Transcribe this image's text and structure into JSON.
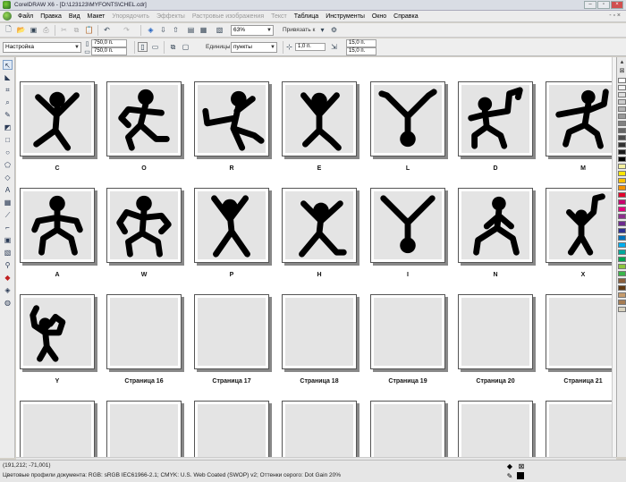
{
  "window": {
    "title": "CorelDRAW X6 - [D:\\123123\\MYFONTS\\CHEL.cdr]"
  },
  "menu": {
    "items": [
      {
        "label": "Файл",
        "enabled": true
      },
      {
        "label": "Правка",
        "enabled": true
      },
      {
        "label": "Вид",
        "enabled": true
      },
      {
        "label": "Макет",
        "enabled": true
      },
      {
        "label": "Упорядочить",
        "enabled": false
      },
      {
        "label": "Эффекты",
        "enabled": false
      },
      {
        "label": "Растровые изображения",
        "enabled": false
      },
      {
        "label": "Текст",
        "enabled": false
      },
      {
        "label": "Таблица",
        "enabled": true
      },
      {
        "label": "Инструменты",
        "enabled": true
      },
      {
        "label": "Окно",
        "enabled": true
      },
      {
        "label": "Справка",
        "enabled": true
      }
    ],
    "right_controls": "- ▫ ×"
  },
  "toolbar": {
    "zoom": "63%",
    "snap_label": "Привязать к"
  },
  "property_bar": {
    "preset": "Настройка",
    "width": "750,0 п.",
    "height": "750,0 п.",
    "units_label": "Единицы:",
    "units_value": "пункты",
    "nudge": "1,0 п.",
    "dup_x": "15,0 п.",
    "dup_y": "15,0 п."
  },
  "pages": [
    {
      "caption": "C",
      "glyph": "C"
    },
    {
      "caption": "O",
      "glyph": "O"
    },
    {
      "caption": "R",
      "glyph": "R"
    },
    {
      "caption": "E",
      "glyph": "E"
    },
    {
      "caption": "L",
      "glyph": "L"
    },
    {
      "caption": "D",
      "glyph": "D"
    },
    {
      "caption": "M",
      "glyph": "M"
    },
    {
      "caption": "A",
      "glyph": "A"
    },
    {
      "caption": "W",
      "glyph": "W"
    },
    {
      "caption": "P",
      "glyph": "P"
    },
    {
      "caption": "H",
      "glyph": "H"
    },
    {
      "caption": "I",
      "glyph": "I"
    },
    {
      "caption": "N",
      "glyph": "N"
    },
    {
      "caption": "X",
      "glyph": "X"
    },
    {
      "caption": "Y",
      "glyph": "Y"
    },
    {
      "caption": "Страница 16",
      "glyph": ""
    },
    {
      "caption": "Страница 17",
      "glyph": ""
    },
    {
      "caption": "Страница 18",
      "glyph": ""
    },
    {
      "caption": "Страница 19",
      "glyph": ""
    },
    {
      "caption": "Страница 20",
      "glyph": ""
    },
    {
      "caption": "Страница 21",
      "glyph": ""
    },
    {
      "caption": "",
      "glyph": ""
    },
    {
      "caption": "",
      "glyph": ""
    },
    {
      "caption": "",
      "glyph": ""
    },
    {
      "caption": "",
      "glyph": ""
    },
    {
      "caption": "",
      "glyph": ""
    },
    {
      "caption": "",
      "glyph": ""
    },
    {
      "caption": "",
      "glyph": ""
    }
  ],
  "palette": {
    "colors": [
      "#ffffff",
      "#f2f2f2",
      "#e0e0e0",
      "#cccccc",
      "#b3b3b3",
      "#999999",
      "#808080",
      "#666666",
      "#4d4d4d",
      "#333333",
      "#1a1a1a",
      "#000000",
      "#f4f0a0",
      "#ffe600",
      "#f8c000",
      "#f39200",
      "#e4002b",
      "#c8006e",
      "#e5007e",
      "#8e2f8e",
      "#6d2a8e",
      "#2e3192",
      "#0072bc",
      "#00aeef",
      "#00a99d",
      "#00a651",
      "#8dc63f",
      "#39b54a",
      "#8b5e3c",
      "#603913",
      "#c69c6d",
      "#a67c52",
      "#d9d3c0"
    ]
  },
  "status": {
    "coords": "(191,212; -71,001)",
    "profile": "Цветовые профили документа: RGB: sRGB IEC61966-2.1; CMYK: U.S. Web Coated (SWOP) v2; Оттенки серого: Dot Gain 20%"
  },
  "colors": {
    "accent": "#2060c0",
    "glyph": "#000000",
    "page_fill": "#e4e4e4"
  }
}
